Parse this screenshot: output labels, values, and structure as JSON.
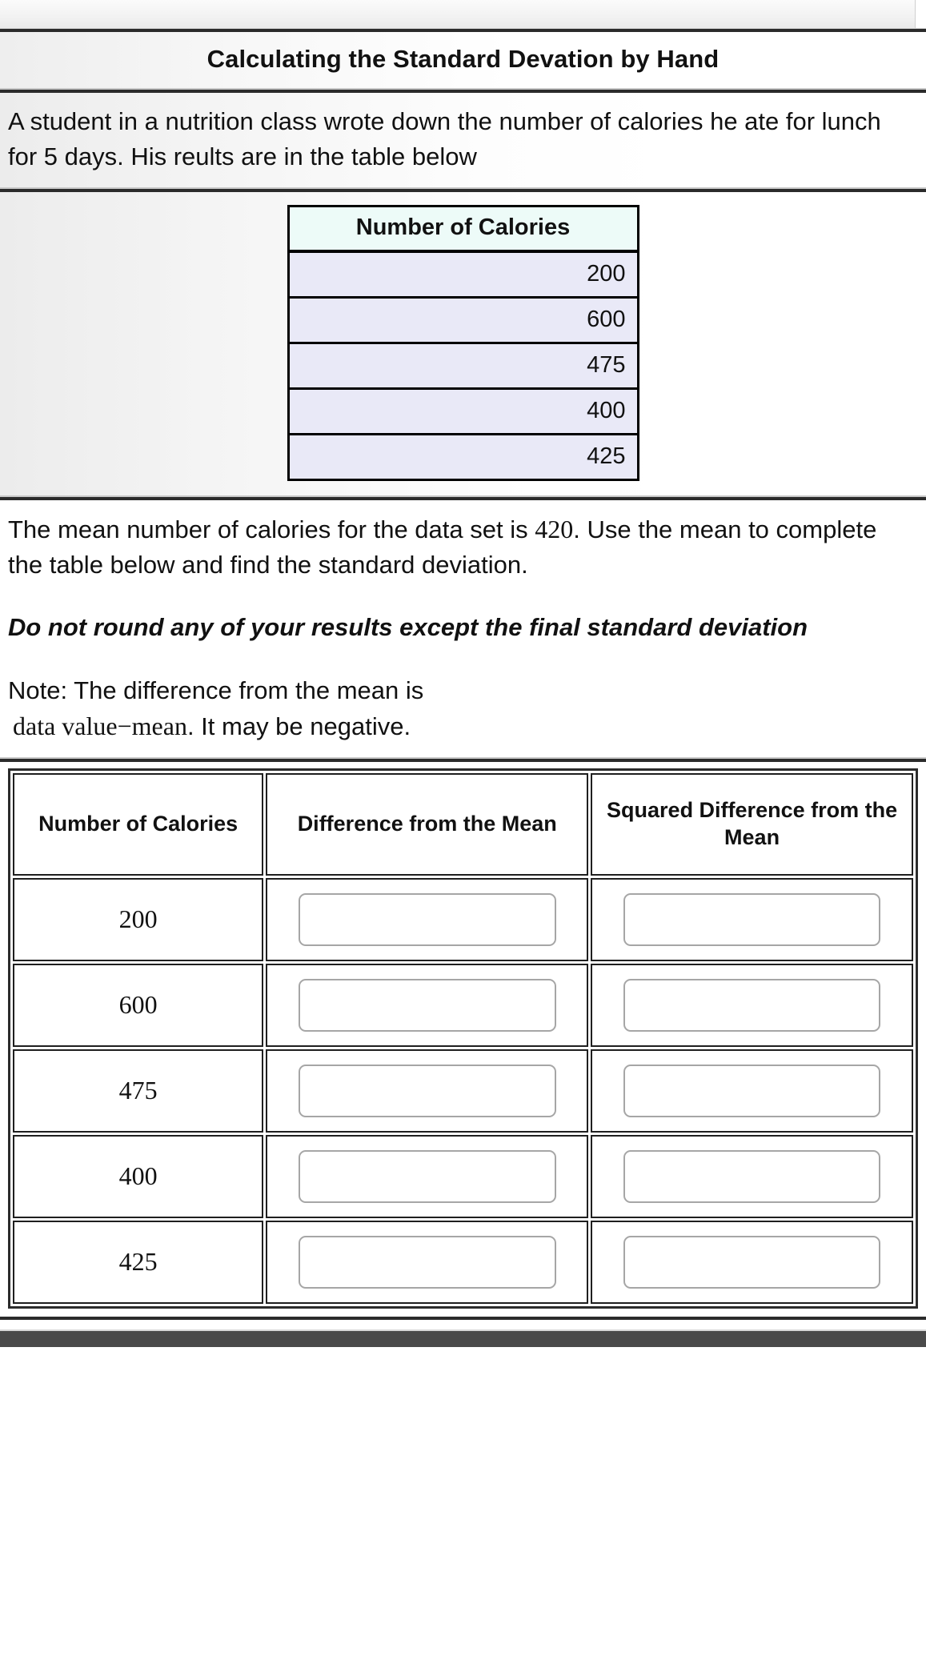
{
  "header": {
    "title": "Calculating the Standard Devation by Hand"
  },
  "intro": {
    "text": "A student in a nutrition class wrote down the number of calories he ate for lunch for 5 days. His reults are in the table below"
  },
  "calories_table": {
    "header": "Number of Calories",
    "values": [
      "200",
      "600",
      "475",
      "400",
      "425"
    ]
  },
  "instructions": {
    "mean_text_before": "The mean number of calories for the data set is ",
    "mean_value": "420",
    "mean_text_after": ". Use the mean to complete the table below and find the standard deviation.",
    "warning": "Do not round any of your results except the final standard deviation",
    "note_label": "Note: The difference from the mean is",
    "note_formula": "data value−mean",
    "note_suffix": ". It may be negative."
  },
  "worksheet": {
    "columns": [
      "Number of Calories",
      "Difference from the Mean",
      "Squared Difference from the Mean"
    ],
    "rows": [
      {
        "calories": "200",
        "difference": "",
        "squared": ""
      },
      {
        "calories": "600",
        "difference": "",
        "squared": ""
      },
      {
        "calories": "475",
        "difference": "",
        "squared": ""
      },
      {
        "calories": "400",
        "difference": "",
        "squared": ""
      },
      {
        "calories": "425",
        "difference": "",
        "squared": ""
      }
    ]
  },
  "colors": {
    "table_header_bg": "#edfbf8",
    "table_row_bg": "#e9e9f7",
    "rule": "#2b2b2b",
    "input_border": "#a6a6a6"
  }
}
